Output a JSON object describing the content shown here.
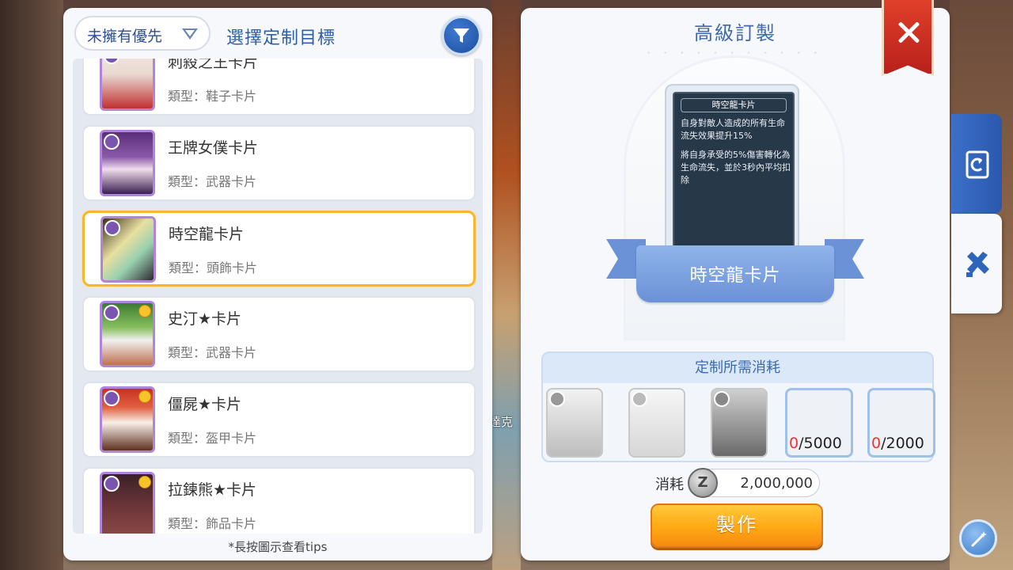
{
  "left_panel": {
    "dropdown_label": "未擁有優先",
    "title": "選擇定制目標",
    "items": [
      {
        "name": "刺殺之王卡片",
        "type": "類型：鞋子卡片",
        "avatar_color": "#d84a3a",
        "has_star": false
      },
      {
        "name": "王牌女僕卡片",
        "type": "類型：武器卡片",
        "avatar_color": "#6a3e90",
        "has_star": false
      },
      {
        "name": "時空龍卡片",
        "type": "類型：頭飾卡片",
        "avatar_color": "#d8d090",
        "has_star": false
      },
      {
        "name": "史汀★卡片",
        "type": "類型：武器卡片",
        "avatar_color": "#5aa048",
        "has_star": true
      },
      {
        "name": "僵屍★卡片",
        "type": "類型：盔甲卡片",
        "avatar_color": "#d04030",
        "has_star": true
      },
      {
        "name": "拉鍊熊★卡片",
        "type": "類型：飾品卡片",
        "avatar_color": "#703a40",
        "has_star": true
      }
    ],
    "hint": "*長按圖示查看tips"
  },
  "right_panel": {
    "title": "高級訂製",
    "card": {
      "title": "時空龍卡片",
      "desc1": "自身對敵人造成的所有生命流失效果提升15%",
      "desc2": "將自身承受的5%傷害轉化為生命流失，並於3秒內平均扣除",
      "banner": "時空龍卡片"
    },
    "cost": {
      "header": "定制所需消耗",
      "materials": [
        {
          "have": "0",
          "need": "/5000"
        },
        {
          "have": "0",
          "need": "/2000"
        }
      ]
    },
    "consume_label": "消耗",
    "zeny_icon": "Z",
    "zeny_value": "2,000,000",
    "craft_label": "製作"
  },
  "background": {
    "side_text": "達克"
  },
  "colors": {
    "accent": "#2d5ea8",
    "selected_border": "#f6b82a",
    "close": "#d0301e",
    "craft": "#ffa814"
  }
}
